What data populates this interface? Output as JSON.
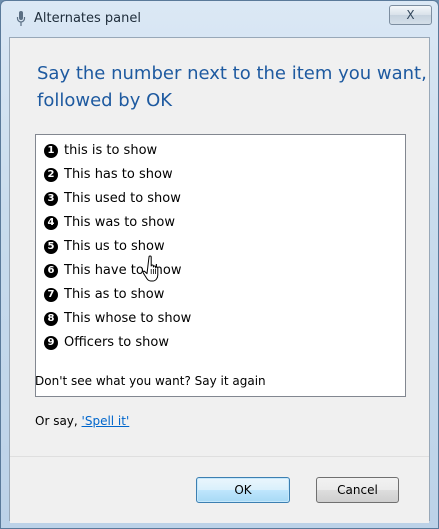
{
  "window": {
    "title": "Alternates panel",
    "close_label": "X",
    "title_icon": "microphone-icon"
  },
  "instruction": "Say the number next to the item you want, followed by OK",
  "alternates": [
    {
      "number": "1",
      "text": "this is to show"
    },
    {
      "number": "2",
      "text": "This has to show"
    },
    {
      "number": "3",
      "text": "This used to show"
    },
    {
      "number": "4",
      "text": "This was to show"
    },
    {
      "number": "5",
      "text": "This us to show"
    },
    {
      "number": "6",
      "text": "This have to show"
    },
    {
      "number": "7",
      "text": "This as to show"
    },
    {
      "number": "8",
      "text": "This whose to show"
    },
    {
      "number": "9",
      "text": "Officers to show"
    }
  ],
  "hint": "Don't see what you want? Say it again",
  "or_say": {
    "prefix": "Or say, ",
    "link": "'Spell it'"
  },
  "buttons": {
    "ok": "OK",
    "cancel": "Cancel"
  },
  "colors": {
    "instruction_text": "#1e5aa0",
    "link": "#0066cc",
    "ok_border": "#3c7fb1"
  },
  "cursor_icon": "hand-pointer-icon"
}
